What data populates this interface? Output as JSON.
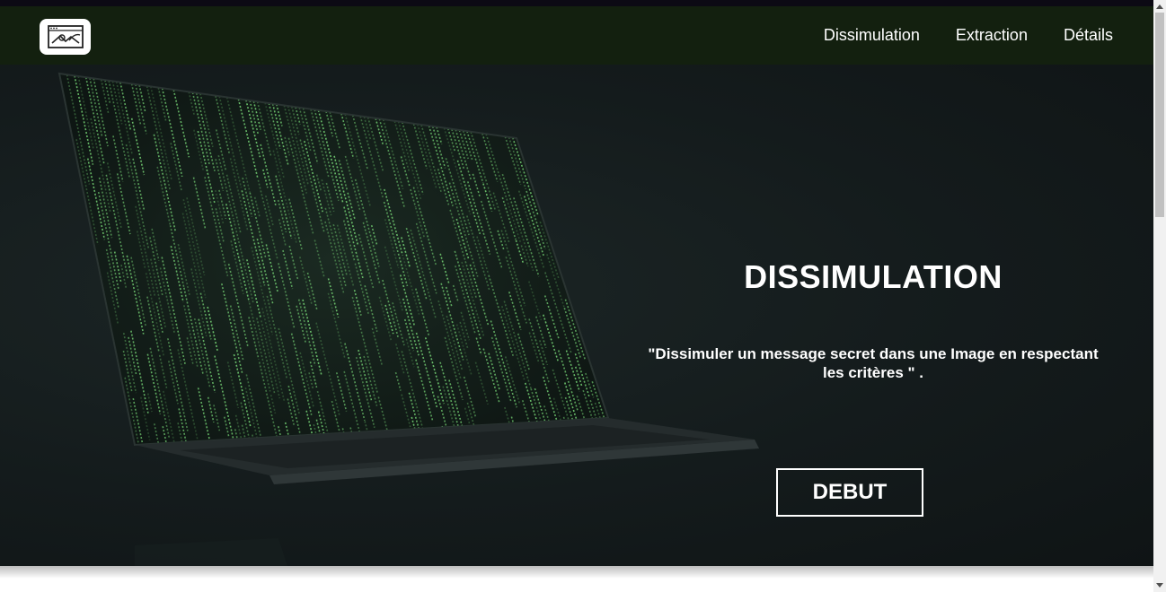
{
  "nav": {
    "logo_icon": "image-signature-icon",
    "links": [
      "Dissimulation",
      "Extraction",
      "Détails"
    ]
  },
  "hero": {
    "background_image": "laptop-matrix-code-photo",
    "title": "DISSIMULATION",
    "subtitle_line1": "\"Dissimuler un message secret dans une Image en respectant",
    "subtitle_line2": "les critères \" .",
    "button_label": "DEBUT"
  },
  "colors": {
    "navbar_bg": "#13200f",
    "hero_bg": "#141b1c",
    "matrix_green": "#6fc76f",
    "text": "#ffffff"
  }
}
